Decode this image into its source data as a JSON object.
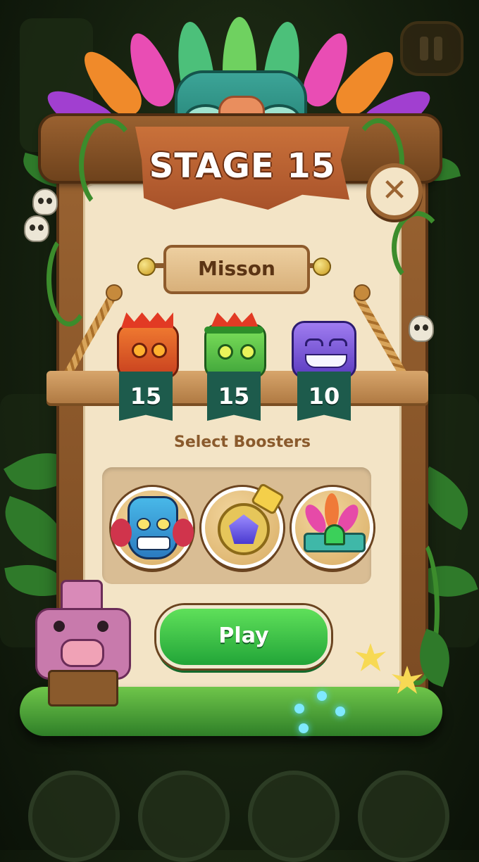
{
  "stage": {
    "title": "STAGE 15"
  },
  "mission": {
    "label": "Misson",
    "goals": [
      {
        "icon": "red-mask-tile-icon",
        "count": "15",
        "color": "#e0542a"
      },
      {
        "icon": "green-mask-tile-icon",
        "count": "15",
        "color": "#62cf4f"
      },
      {
        "icon": "purple-mask-tile-icon",
        "count": "10",
        "color": "#7e57d8"
      }
    ]
  },
  "boosters": {
    "title": "Select Boosters",
    "items": [
      {
        "icon": "tiki-mask-booster-icon"
      },
      {
        "icon": "gem-amulet-booster-icon"
      },
      {
        "icon": "feather-crown-booster-icon"
      }
    ]
  },
  "play_label": "Play",
  "colors": {
    "panel": "#f3e4c6",
    "wood": "#9b6432",
    "banner": "#c9713a",
    "play": "#36c043",
    "tag": "#1d5b4c"
  }
}
